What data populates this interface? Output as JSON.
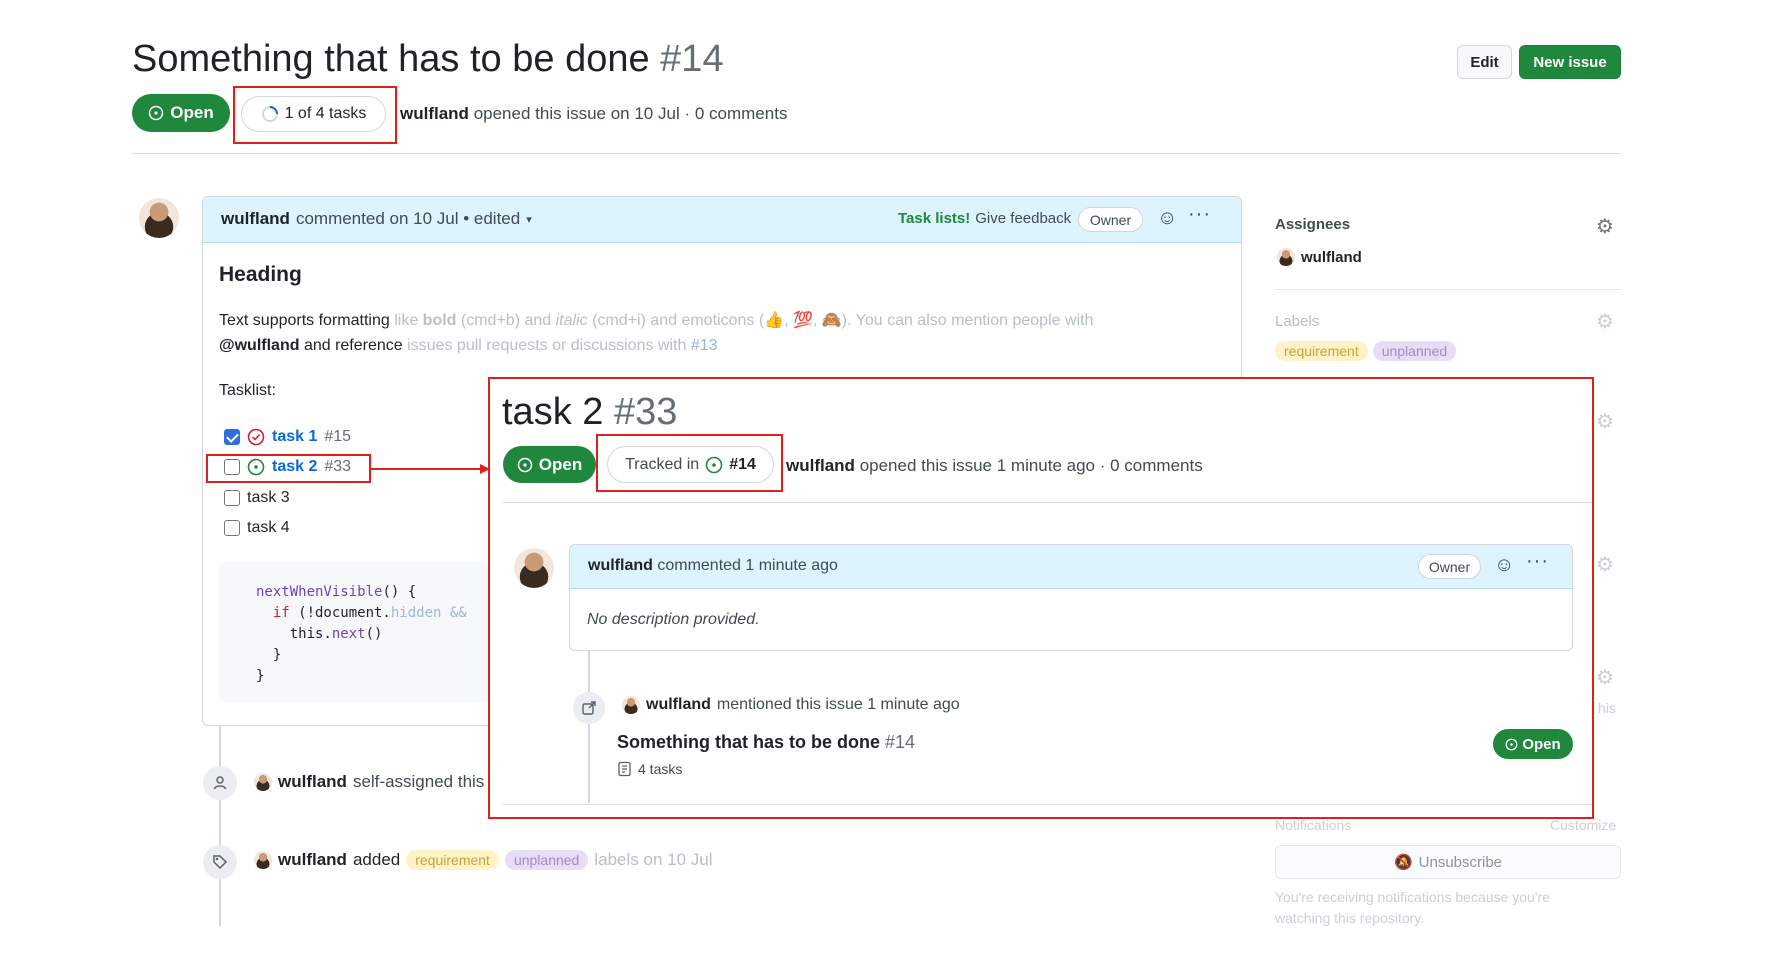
{
  "header": {
    "title": "Something that has to be done",
    "number": "#14",
    "edit_label": "Edit",
    "new_issue_label": "New issue",
    "status": "Open",
    "tasks_progress": "1 of 4 tasks",
    "tasks_progress_fraction": 0.25,
    "author": "wulfland",
    "meta": "opened this issue on 10 Jul · 0 comments"
  },
  "comment": {
    "author": "wulfland",
    "meta": "commented on 10 Jul • edited",
    "tasklists_label": "Task lists!",
    "give_feedback": "Give feedback",
    "owner_badge": "Owner",
    "heading": "Heading",
    "p1_a": "Text supports formatting",
    "p1_b": "like",
    "p1_c": "bold",
    "p1_d": "(cmd+b) and",
    "p1_e": "italic",
    "p1_f": "(cmd+i) and emoticons (👍, 💯, 🙈). You can also mention people with",
    "p2_a": "@wulfland",
    "p2_b": "and reference",
    "p2_c": "issues pull requests or discussions with",
    "p2_d": "#13",
    "tasklist_label": "Tasklist:",
    "tasks": [
      {
        "label": "task 1",
        "ref": "#15",
        "checked": true
      },
      {
        "label": "task 2",
        "ref": "#33",
        "checked": false
      },
      {
        "label": "task 3",
        "ref": "",
        "checked": false
      },
      {
        "label": "task 4",
        "ref": "",
        "checked": false
      }
    ],
    "code": {
      "l1a": "nextWhenVisible",
      "l1b": "() {",
      "l2a": "if",
      "l2b": " (!document.",
      "l2c": "hidden && ",
      "l3a": "this.",
      "l3b": "next",
      "l3c": "()",
      "l4": "}",
      "l5": "}"
    }
  },
  "timeline": {
    "assigned_author": "wulfland",
    "assigned_text": "self-assigned this",
    "labels_author": "wulfland",
    "labels_added": "added",
    "labels_suffix": "labels on 10 Jul"
  },
  "sidebar": {
    "assignees_label": "Assignees",
    "assignee": "wulfland",
    "labels_label": "Labels",
    "labels": [
      "requirement",
      "unplanned"
    ],
    "notifications_label": "Notifications",
    "customize_label": "Customize",
    "unsubscribe_label": "Unsubscribe",
    "notifications_note_1": "You're receiving notifications because you're",
    "notifications_note_2": "watching this repository.",
    "partial_his": "his"
  },
  "overlay": {
    "title": "task 2",
    "number": "#33",
    "status": "Open",
    "tracked_in_label": "Tracked in",
    "tracked_in_ref": "#14",
    "author": "wulfland",
    "meta": "opened this issue 1 minute ago · 0 comments",
    "comment_author": "wulfland",
    "comment_meta": "commented 1 minute ago",
    "owner_badge": "Owner",
    "no_description": "No description provided.",
    "mention_author": "wulfland",
    "mention_text": "mentioned this issue 1 minute ago",
    "ref_title": "Something that has to be done",
    "ref_number": "#14",
    "ref_tasks": "4 tasks",
    "ref_status": "Open"
  },
  "colors": {
    "green": "#1f883d",
    "red_annotation": "#e01e1e",
    "link_blue": "#0969da"
  }
}
